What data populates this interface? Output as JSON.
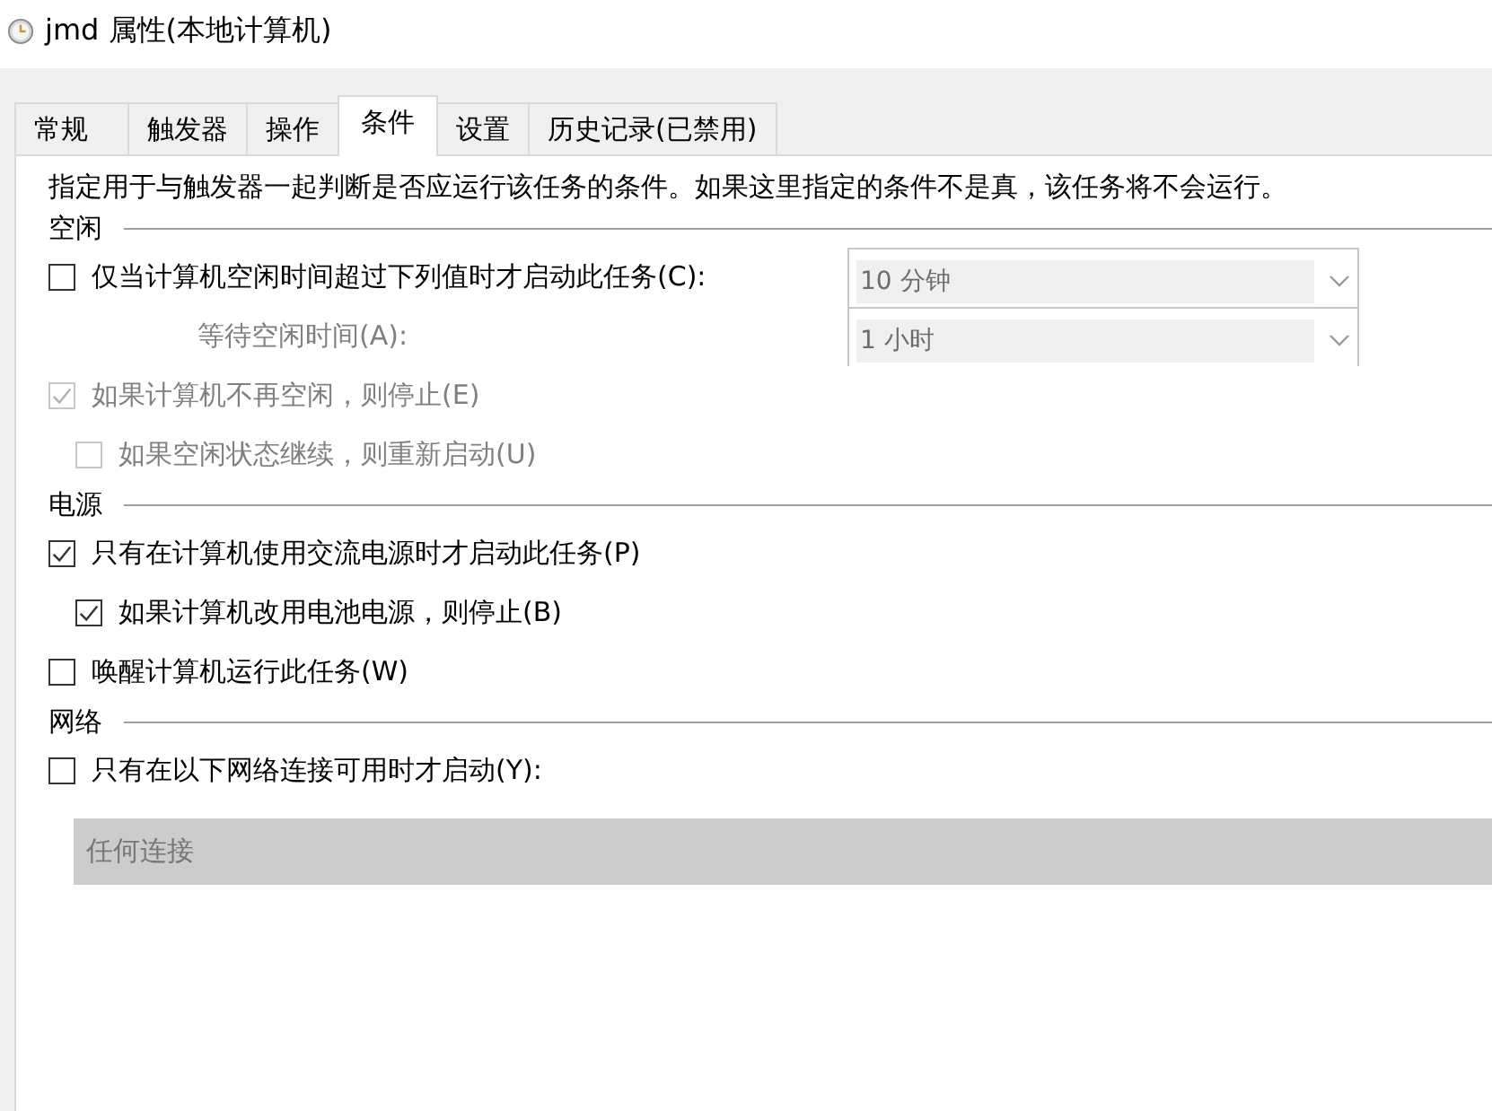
{
  "window": {
    "title": "jmd 属性(本地计算机)"
  },
  "tabs": [
    {
      "label": "常规",
      "selected": false
    },
    {
      "label": "触发器",
      "selected": false
    },
    {
      "label": "操作",
      "selected": false
    },
    {
      "label": "条件",
      "selected": true
    },
    {
      "label": "设置",
      "selected": false
    },
    {
      "label": "历史记录(已禁用)",
      "selected": false
    }
  ],
  "description": "指定用于与触发器一起判断是否应运行该任务的条件。如果这里指定的条件不是真，该任务将不会运行。",
  "sections": [
    {
      "title": "空闲",
      "items": [
        {
          "kind": "checkbox",
          "label": "仅当计算机空闲时间超过下列值时才启动此任务(C):",
          "checked": false,
          "disabled": false,
          "dropdown": {
            "value": "10 分钟",
            "disabled": true
          }
        },
        {
          "kind": "dropdown",
          "label": "等待空闲时间(A):",
          "disabled": true,
          "dropdown": {
            "value": "1 小时",
            "disabled": true
          }
        },
        {
          "kind": "checkbox",
          "label": "如果计算机不再空闲，则停止(E)",
          "checked": true,
          "disabled": true,
          "children": [
            {
              "kind": "checkbox",
              "label": "如果空闲状态继续，则重新启动(U)",
              "checked": false,
              "disabled": true
            }
          ]
        }
      ]
    },
    {
      "title": "电源",
      "items": [
        {
          "kind": "checkbox",
          "label": "只有在计算机使用交流电源时才启动此任务(P)",
          "checked": true,
          "disabled": false,
          "children": [
            {
              "kind": "checkbox",
              "label": "如果计算机改用电池电源，则停止(B)",
              "checked": true,
              "disabled": false
            }
          ]
        },
        {
          "kind": "checkbox",
          "label": "唤醒计算机运行此任务(W)",
          "checked": false,
          "disabled": false
        }
      ]
    },
    {
      "title": "网络",
      "items": [
        {
          "kind": "checkbox",
          "label": "只有在以下网络连接可用时才启动(Y):",
          "checked": false,
          "disabled": false
        },
        {
          "kind": "wide-dropdown",
          "value": "任何连接",
          "disabled": true
        }
      ]
    }
  ]
}
